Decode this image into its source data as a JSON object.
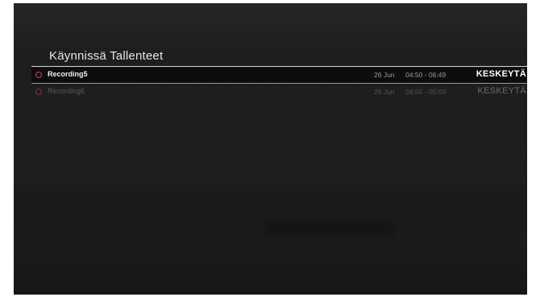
{
  "header": {
    "title": "Käynnissä Tallenteet"
  },
  "recordings": [
    {
      "name": "Recording5",
      "date": "26 Jun",
      "time": "04:50 - 06:49",
      "action": "KESKEYTÄ",
      "selected": true
    },
    {
      "name": "Recording6",
      "date": "26 Jun",
      "time": "04:55 - 05:03",
      "action": "KESKEYTÄ",
      "selected": false
    }
  ],
  "colors": {
    "accent": "#e0306a",
    "background": "#1e1e1e",
    "text": "#f0f0f0"
  },
  "icons": {
    "recording": "record-circle-icon"
  }
}
